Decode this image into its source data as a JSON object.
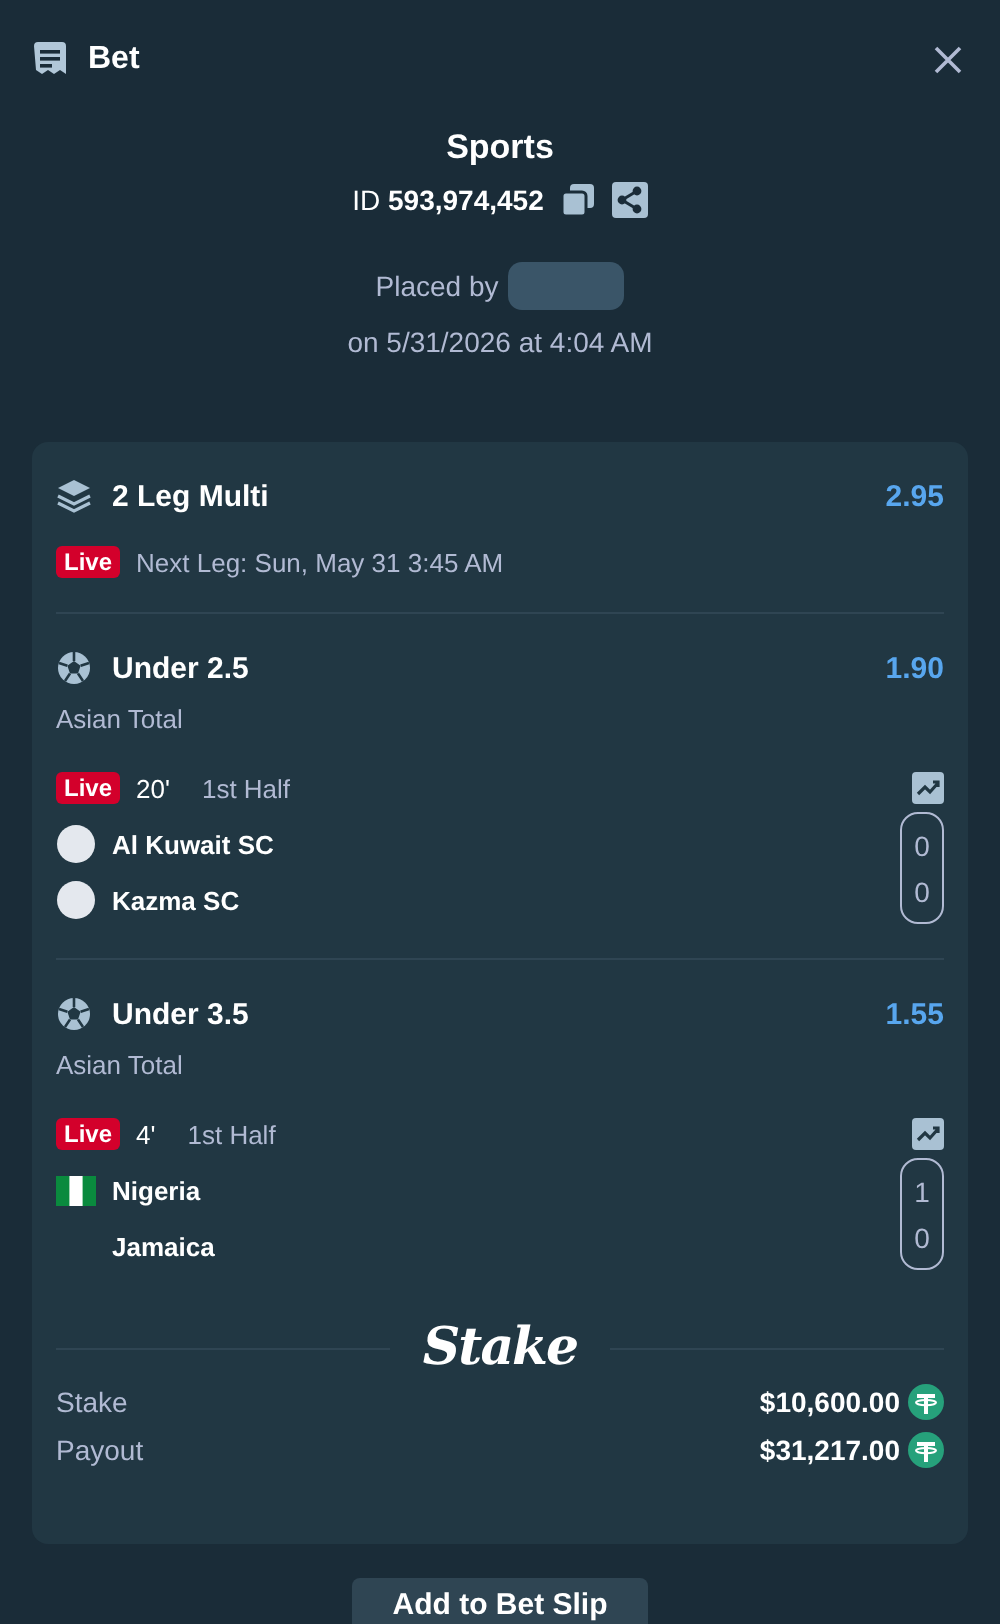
{
  "header": {
    "title": "Bet"
  },
  "summary": {
    "sport": "Sports",
    "id_label": "ID",
    "id_value": "593,974,452",
    "placed_by": "Placed by",
    "placed_on": "on 5/31/2026 at 4:04 AM"
  },
  "multi": {
    "title": "2 Leg Multi",
    "odds": "2.95",
    "live": "Live",
    "next_leg": "Next Leg: Sun, May 31 3:45 AM"
  },
  "legs": [
    {
      "title": "Under 2.5",
      "odds": "1.90",
      "market": "Asian Total",
      "live": "Live",
      "clock": "20'",
      "period": "1st Half",
      "teams": [
        {
          "name": "Al Kuwait SC",
          "score": "0",
          "kind": "circle"
        },
        {
          "name": "Kazma SC",
          "score": "0",
          "kind": "circle"
        }
      ]
    },
    {
      "title": "Under 3.5",
      "odds": "1.55",
      "market": "Asian Total",
      "live": "Live",
      "clock": "4'",
      "period": "1st Half",
      "teams": [
        {
          "name": "Nigeria",
          "score": "1",
          "kind": "flag"
        },
        {
          "name": "Jamaica",
          "score": "0",
          "kind": "none"
        }
      ]
    }
  ],
  "logo": "Stake",
  "totals": [
    {
      "label": "Stake",
      "value": "$10,600.00"
    },
    {
      "label": "Payout",
      "value": "$31,217.00"
    }
  ],
  "button": "Add to Bet Slip"
}
